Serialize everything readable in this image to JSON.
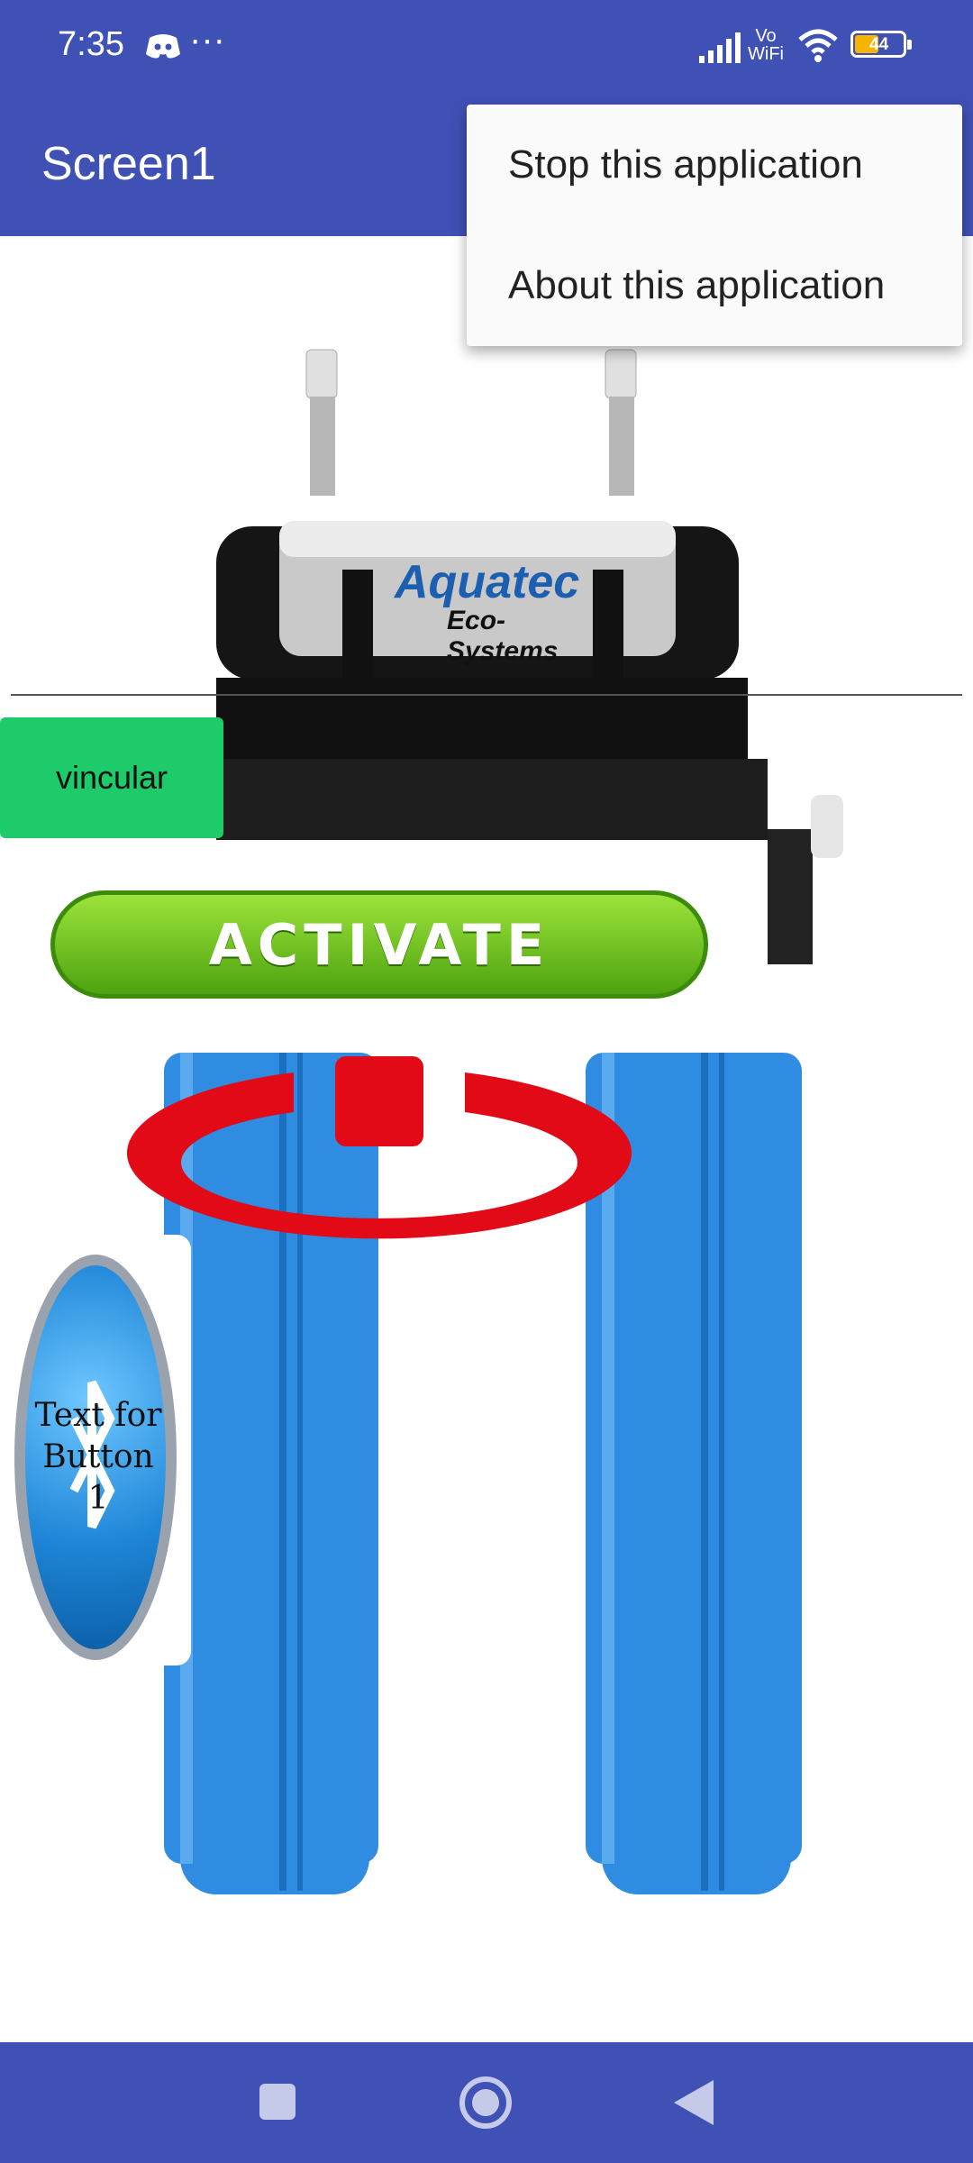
{
  "status_bar": {
    "time": "7:35",
    "network_label_top": "Vo",
    "network_label_bottom": "WiFi",
    "battery_level": "44"
  },
  "app_bar": {
    "title": "Screen1"
  },
  "overflow_menu": {
    "items": [
      {
        "label": "Stop this application"
      },
      {
        "label": "About this application"
      }
    ]
  },
  "main": {
    "product_logo_text": "Aquatec",
    "product_logo_subtext": "Eco-Systems",
    "link_button": {
      "label": "vincular",
      "color": "#1ecb6b"
    },
    "activate_button": {
      "label": "ACTIVATE",
      "color": "#6cc521"
    },
    "bluetooth_button": {
      "label": "Text for Button 1"
    },
    "power_icon_color": "#e10a16",
    "filter_color": "#2f8ce0"
  },
  "colors": {
    "primary": "#3f51b5"
  },
  "nav_bar": {
    "icons": [
      "recents-square-icon",
      "home-circle-icon",
      "back-triangle-icon"
    ]
  }
}
